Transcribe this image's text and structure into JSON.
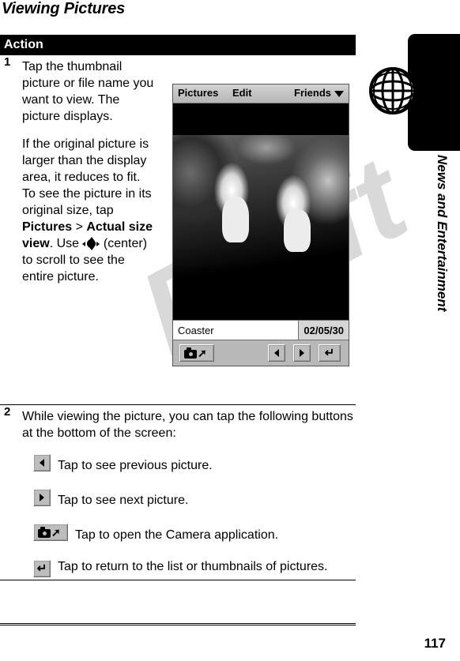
{
  "document": {
    "title": "Viewing Pictures",
    "page_number": "117",
    "watermark": "Draft",
    "side_tab_label": "News and Entertainment",
    "side_tab_icon": "globe-icon"
  },
  "table": {
    "header": "Action",
    "steps": [
      {
        "number": "1",
        "paragraph_1": "Tap the thumbnail picture or file name you want to view. The picture displays.",
        "paragraph_2_part_1": "If the original picture is larger than the display area, it reduces to fit. To see the picture in its original size, tap ",
        "paragraph_2_bold_1": "Pictures",
        "paragraph_2_part_2": " > ",
        "paragraph_2_bold_2": "Actual size view",
        "paragraph_2_part_3": ". Use ",
        "paragraph_2_part_4": " (center) to scroll to see the entire picture."
      },
      {
        "number": "2",
        "intro": "While viewing the picture, you can tap the following buttons at the bottom of the screen:",
        "buttons": [
          {
            "icon": "previous-arrow-icon",
            "label": "Tap to see previous picture."
          },
          {
            "icon": "next-arrow-icon",
            "label": "Tap to see next picture."
          },
          {
            "icon": "camera-icon",
            "label": "Tap to open the Camera application."
          },
          {
            "icon": "return-arrow-icon",
            "label": "Tap to return to the list or thumbnails of pictures."
          }
        ]
      }
    ]
  },
  "device_screenshot": {
    "menubar": {
      "item_1": "Pictures",
      "item_2": "Edit",
      "item_3": "Friends",
      "caret_icon": "chevron-down-icon"
    },
    "photo": {
      "description": "Black-and-white photo of two people riding a roller coaster"
    },
    "caption": {
      "file_name": "Coaster",
      "date": "02/05/30"
    },
    "toolbar": {
      "camera_icon": "camera-icon",
      "prev_icon": "previous-arrow-icon",
      "next_icon": "next-arrow-icon",
      "return_icon": "return-arrow-icon"
    }
  },
  "colors": {
    "header_bar": "#000000",
    "header_text": "#ffffff",
    "device_chrome": "#bdbdbd",
    "watermark": "#d9d9d9"
  }
}
